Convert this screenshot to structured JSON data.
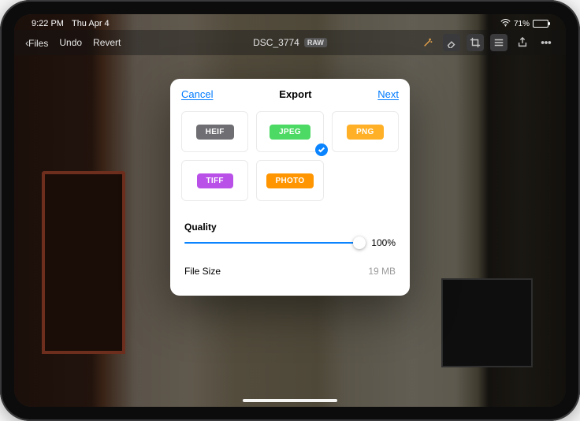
{
  "status": {
    "time": "9:22 PM",
    "date": "Thu Apr 4",
    "battery_pct": "71%",
    "battery_level": 71
  },
  "appbar": {
    "back_label": "Files",
    "undo_label": "Undo",
    "revert_label": "Revert",
    "filename": "DSC_3774",
    "raw_badge": "RAW"
  },
  "modal": {
    "cancel": "Cancel",
    "title": "Export",
    "next": "Next",
    "quality_label": "Quality",
    "quality_value": "100%",
    "filesize_label": "File Size",
    "filesize_value": "19 MB",
    "selected": "jpeg",
    "formats": {
      "heif": {
        "label": "HEIF",
        "color": "#6e6e73"
      },
      "jpeg": {
        "label": "JPEG",
        "color": "#4cd964"
      },
      "png": {
        "label": "PNG",
        "color": "#ffb027"
      },
      "tiff": {
        "label": "TIFF",
        "color": "#b950e8"
      },
      "photo": {
        "label": "PHOTO",
        "color": "#ff9500"
      }
    }
  }
}
